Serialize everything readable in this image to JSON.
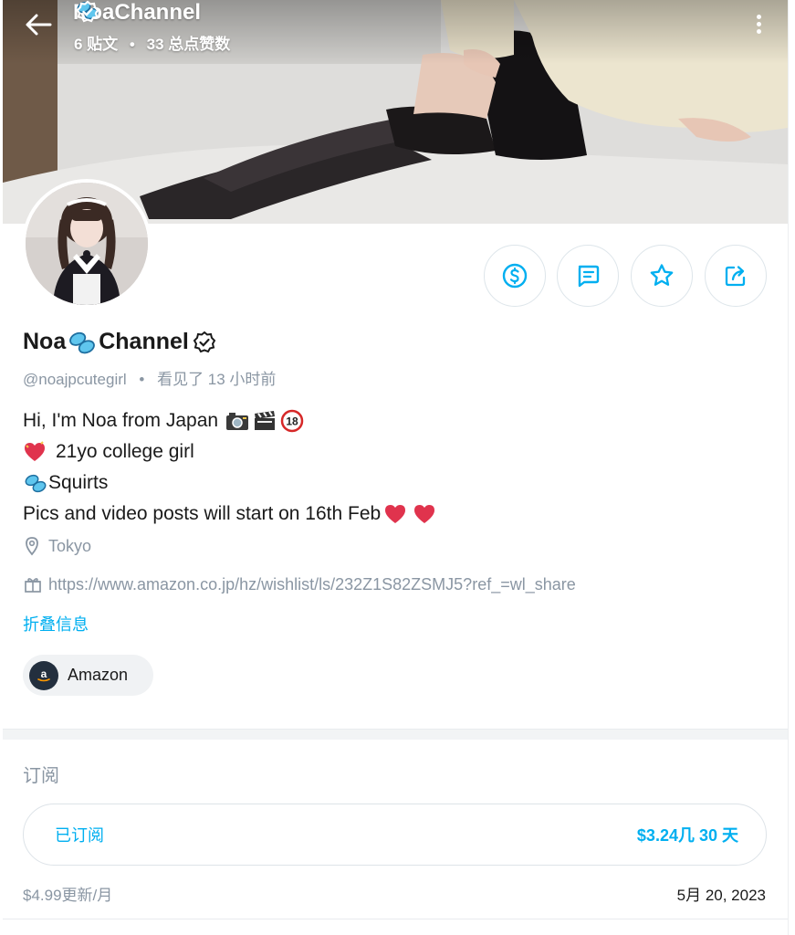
{
  "header": {
    "name_part1": "Noa",
    "name_part2": "Channel",
    "posts": "6 贴文",
    "likes": "33 总点赞数",
    "separator": "•"
  },
  "profile": {
    "name_part1": "Noa",
    "name_part2": "Channel",
    "handle": "@noajpcutegirl",
    "separator": "•",
    "last_seen": "看见了 13 小时前",
    "bio": [
      "Hi, I'm Noa from Japan",
      "21yo college girl",
      "Squirts",
      "Pics and video posts will start on 16th Feb"
    ],
    "location": "Tokyo",
    "wishlist_url": "https://www.amazon.co.jp/hz/wishlist/ls/232Z1S82ZSMJ5?ref_=wl_share",
    "collapse_label": "折叠信息",
    "amazon_label": "Amazon"
  },
  "subscription": {
    "section_title": "订阅",
    "status": "已订阅",
    "price": "$3.24几 30 天",
    "renew_text": "$4.99更新/月",
    "date": "5月 20, 2023"
  },
  "icons": {
    "back": "arrow-left-icon",
    "menu": "kebab-menu-icon",
    "verified": "verified-check-icon",
    "tip": "dollar-circle-icon",
    "message": "message-icon",
    "favorite": "star-icon",
    "share": "share-icon",
    "location": "location-pin-icon",
    "wishlist": "gift-icon"
  },
  "colors": {
    "accent": "#00aff0",
    "muted": "#8a96a3",
    "text": "#1a1a1a"
  }
}
